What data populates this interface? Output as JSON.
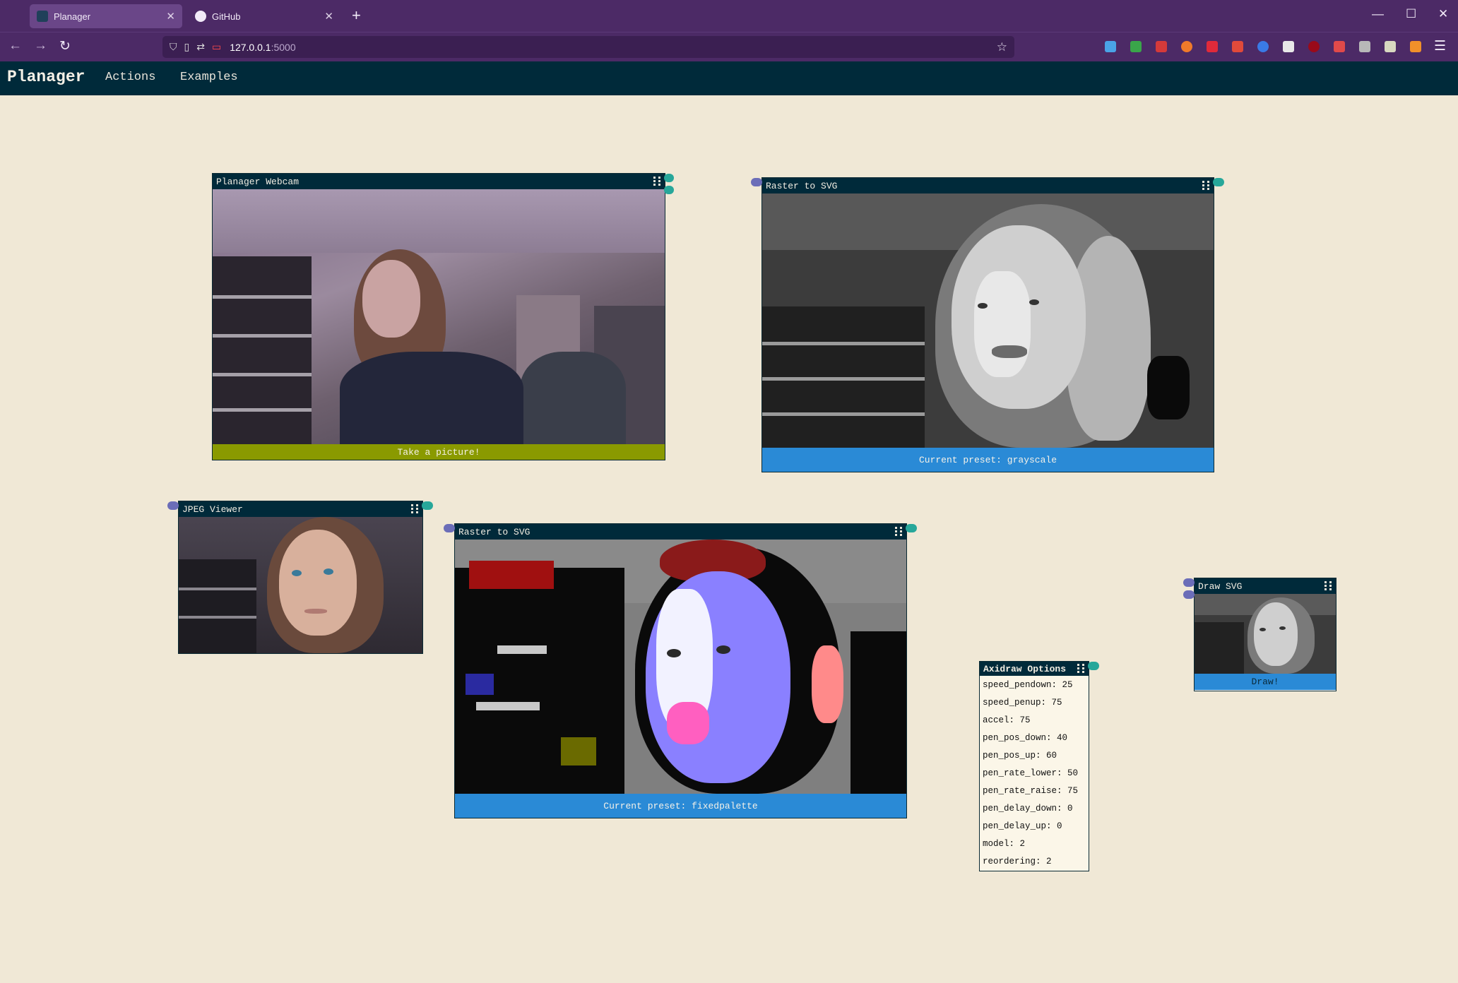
{
  "browser": {
    "tabs": [
      {
        "label": "Planager",
        "active": true
      },
      {
        "label": "GitHub",
        "active": false
      }
    ],
    "url_host": "127.0.0.1",
    "url_port": ":5000",
    "accent": "#4c2a66"
  },
  "app": {
    "brand": "Planager",
    "menu": [
      "Actions",
      "Examples"
    ],
    "background": "#f0e8d6",
    "header_color": "#002a3a"
  },
  "panels": {
    "webcam": {
      "title": "Planager Webcam",
      "button": "Take a picture!",
      "button_color": "#8a9a00"
    },
    "raster1": {
      "title": "Raster to SVG",
      "preset": "Current preset: grayscale",
      "preset_color": "#2a8ad6"
    },
    "jpeg": {
      "title": "JPEG Viewer"
    },
    "raster2": {
      "title": "Raster to SVG",
      "preset": "Current preset: fixedpalette",
      "preset_color": "#2a8ad6"
    },
    "axidraw": {
      "title": "Axidraw Options",
      "options": [
        "speed_pendown: 25",
        "speed_penup: 75",
        "accel: 75",
        "pen_pos_down: 40",
        "pen_pos_up: 60",
        "pen_rate_lower: 50",
        "pen_rate_raise: 75",
        "pen_delay_down: 0",
        "pen_delay_up: 0",
        "model: 2",
        "reordering: 2"
      ]
    },
    "drawsvg": {
      "title": "Draw SVG",
      "button": "Draw!",
      "button_color": "#2a8ad6"
    }
  },
  "icons": [
    "grip-icon",
    "shield-icon",
    "page-icon",
    "star-icon",
    "menu-icon",
    "reload-icon",
    "back-icon",
    "forward-icon"
  ]
}
